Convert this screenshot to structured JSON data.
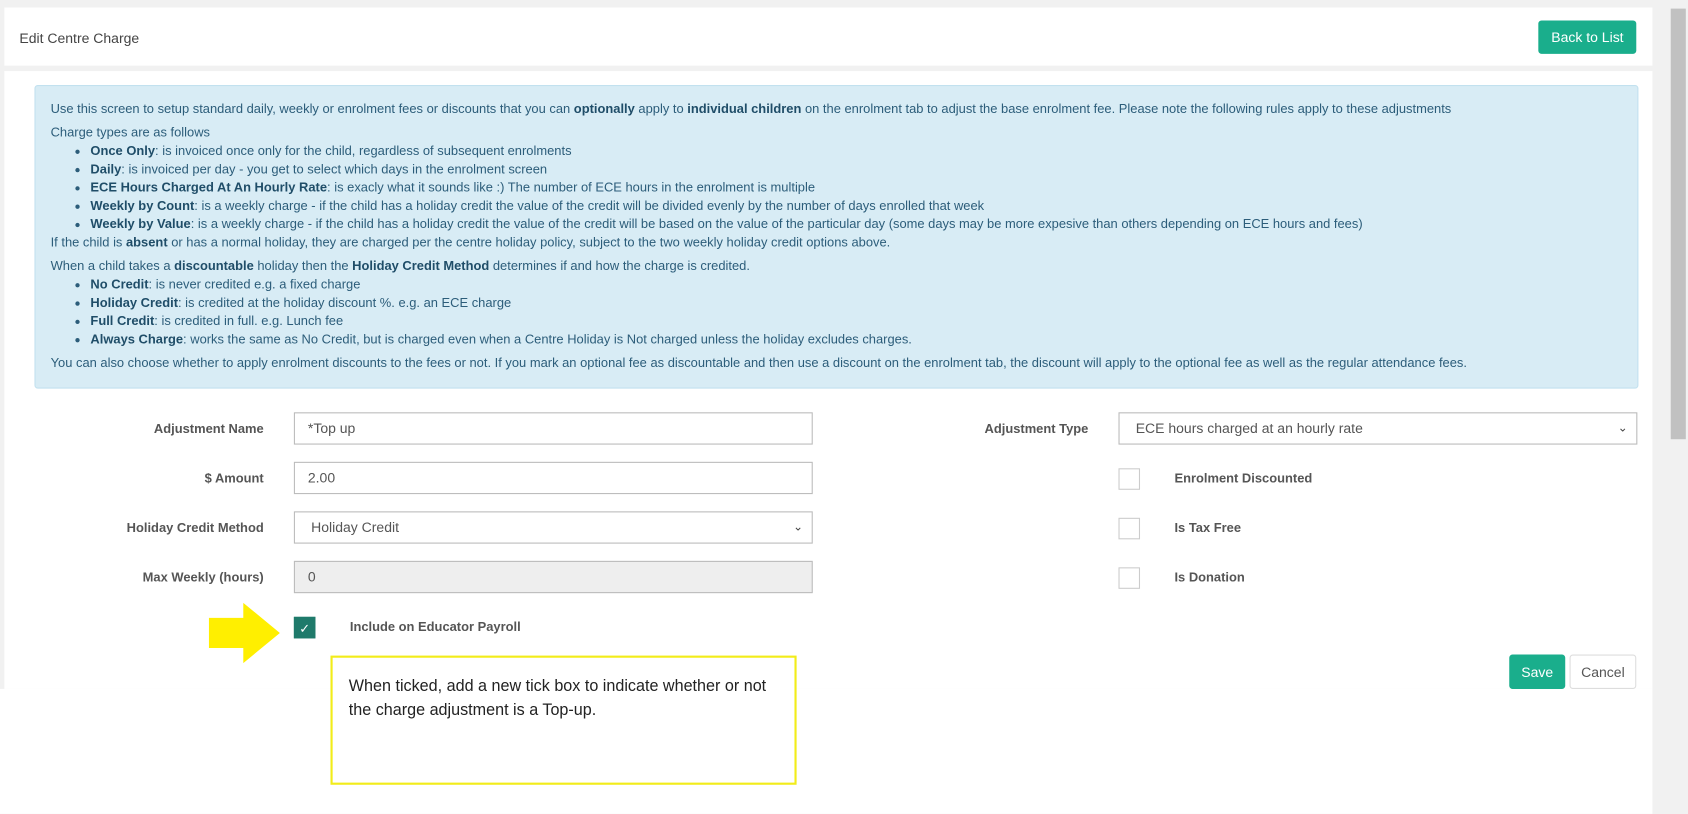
{
  "header": {
    "title": "Edit Centre Charge",
    "back_label": "Back to List"
  },
  "info": {
    "intro_pre": "Use this screen to setup standard daily, weekly or enrolment fees or discounts that you can ",
    "intro_b1": "optionally",
    "intro_mid": " apply to ",
    "intro_b2": "individual children",
    "intro_post": " on the enrolment tab to adjust the base enrolment fee. Please note the following rules apply to these adjustments",
    "types_heading": "Charge types are as follows",
    "types": [
      {
        "term": "Once Only",
        "desc": ": is invoiced once only for the child, regardless of subsequent enrolments"
      },
      {
        "term": "Daily",
        "desc": ": is invoiced per day - you get to select which days in the enrolment screen"
      },
      {
        "term": "ECE Hours Charged At An Hourly Rate",
        "desc": ": is exacly what it sounds like :) The number of ECE hours in the enrolment is multiple"
      },
      {
        "term": "Weekly by Count",
        "desc": ": is a weekly charge - if the child has a holiday credit the value of the credit will be divided evenly by the number of days enrolled that week"
      },
      {
        "term": "Weekly by Value",
        "desc": ": is a weekly charge - if the child has a holiday credit the value of the credit will be based on the value of the particular day (some days may be more expesive than others depending on ECE hours and fees)"
      }
    ],
    "absent_pre": "If the child is ",
    "absent_b": "absent",
    "absent_post": " or has a normal holiday, they are charged per the centre holiday policy, subject to the two weekly holiday credit options above.",
    "holiday_pre": "When a child takes a ",
    "holiday_b1": "discountable",
    "holiday_mid": " holiday then the ",
    "holiday_b2": "Holiday Credit Method",
    "holiday_post": " determines if and how the charge is credited.",
    "methods": [
      {
        "term": "No Credit",
        "desc": ": is never credited e.g. a fixed charge"
      },
      {
        "term": "Holiday Credit",
        "desc": ": is credited at the holiday discount %. e.g. an ECE charge"
      },
      {
        "term": "Full Credit",
        "desc": ": is credited in full. e.g. Lunch fee"
      },
      {
        "term": "Always Charge",
        "desc": ": works the same as No Credit, but is charged even when a Centre Holiday is Not charged unless the holiday excludes charges."
      }
    ],
    "footer": "You can also choose whether to apply enrolment discounts to the fees or not. If you mark an optional fee as discountable and then use a discount on the enrolment tab, the discount will apply to the optional fee as well as the regular attendance fees."
  },
  "form": {
    "adjustment_name_label": "Adjustment Name",
    "adjustment_name_value": "*Top up",
    "amount_label": "$ Amount",
    "amount_value": "2.00",
    "holiday_method_label": "Holiday Credit Method",
    "holiday_method_value": "Holiday Credit",
    "max_weekly_label": "Max Weekly (hours)",
    "max_weekly_value": "0",
    "payroll_label": "Include on Educator Payroll",
    "payroll_checked": true,
    "adjustment_type_label": "Adjustment Type",
    "adjustment_type_value": "ECE hours charged at an hourly rate",
    "enrolment_discounted_label": "Enrolment Discounted",
    "enrolment_discounted_checked": false,
    "tax_free_label": "Is Tax Free",
    "tax_free_checked": false,
    "donation_label": "Is Donation",
    "donation_checked": false,
    "save_label": "Save",
    "cancel_label": "Cancel"
  },
  "annotation": {
    "text": "When ticked, add a new tick box to indicate whether or not the charge adjustment is a Top-up.",
    "color": "#f2ec1a"
  },
  "colors": {
    "accent": "#1aae8c",
    "info_bg": "#d8ecf5"
  }
}
